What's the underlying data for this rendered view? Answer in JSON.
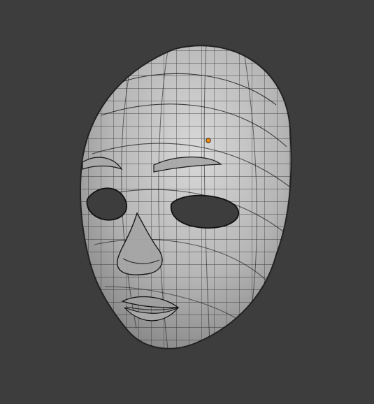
{
  "viewport": {
    "background": "#3d3d3d",
    "mode": "3d-mesh-wireframe-overlay"
  },
  "object": {
    "kind": "mask-face-mesh",
    "surface_color": "#b9b9b9",
    "wire_color": "#111111",
    "origin_color": "#ff8a00"
  }
}
